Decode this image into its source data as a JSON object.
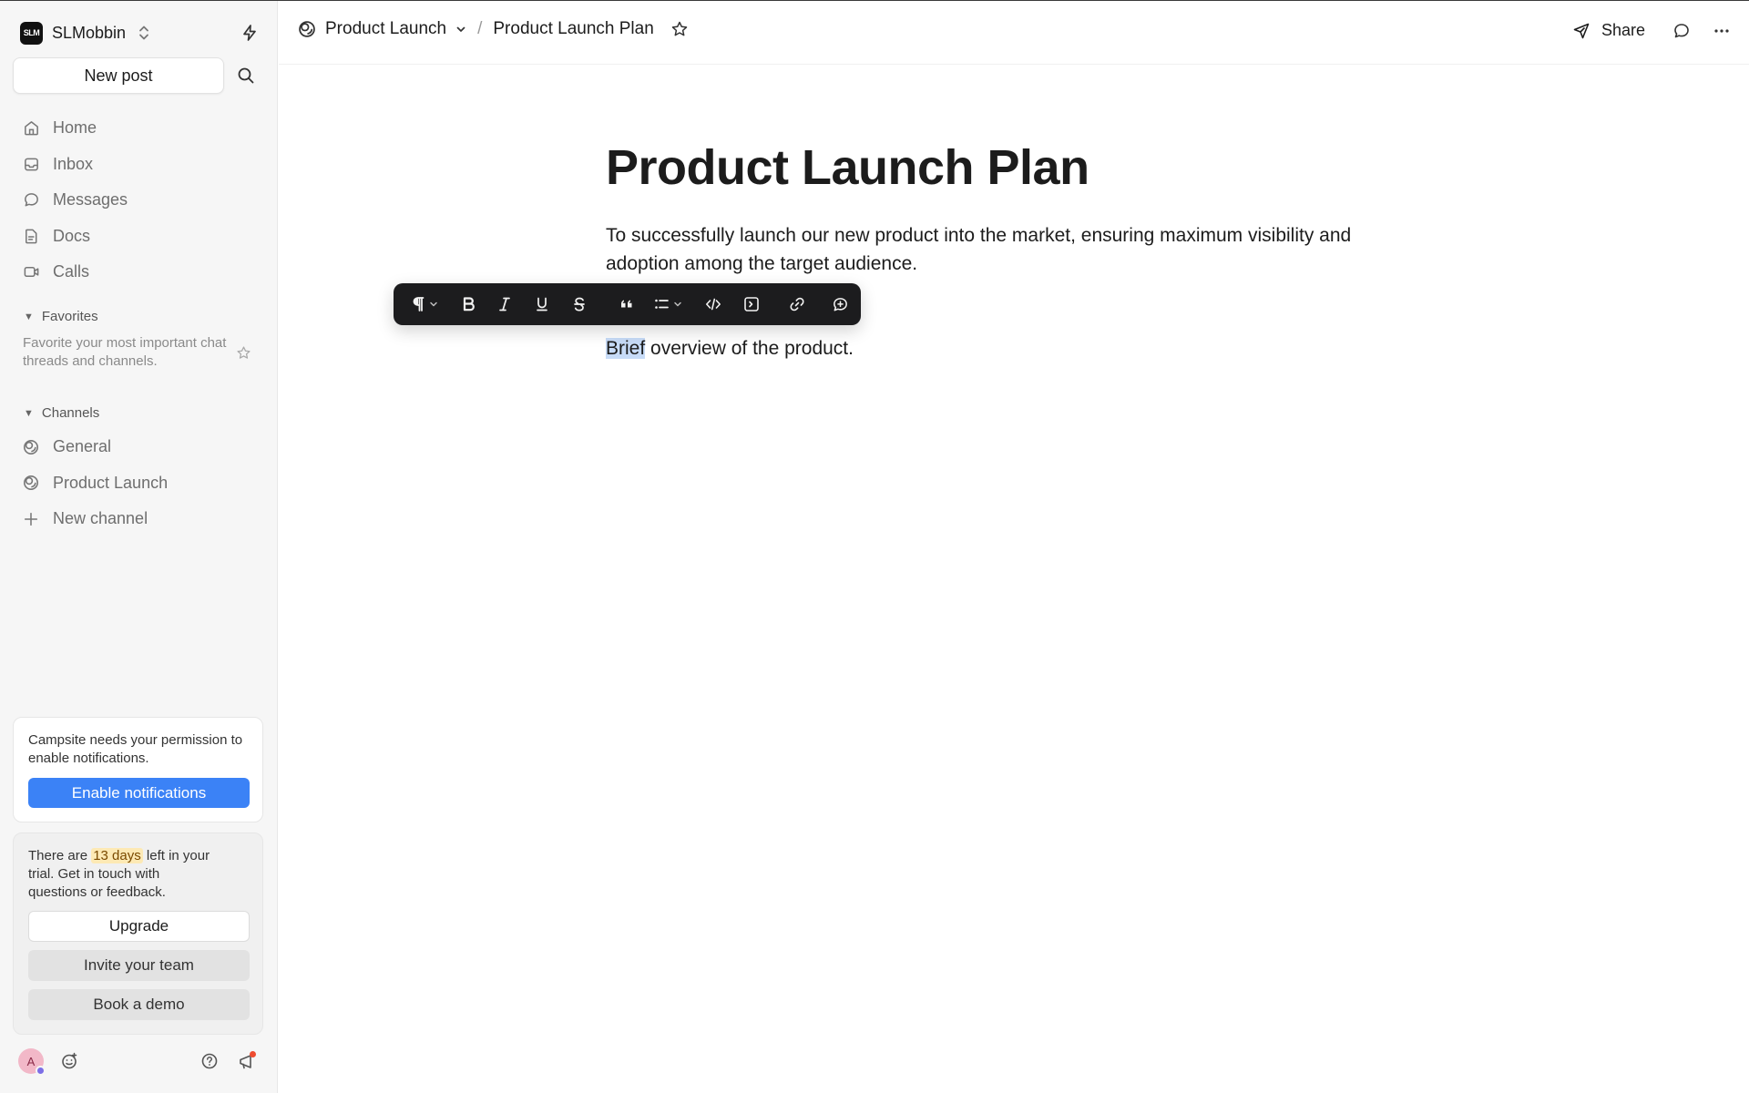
{
  "workspace": {
    "logo_text": "SLM",
    "name": "SLMobbin"
  },
  "sidebar": {
    "new_post_label": "New post",
    "nav": [
      {
        "label": "Home",
        "icon": "home-icon"
      },
      {
        "label": "Inbox",
        "icon": "inbox-icon"
      },
      {
        "label": "Messages",
        "icon": "message-icon"
      },
      {
        "label": "Docs",
        "icon": "doc-icon"
      },
      {
        "label": "Calls",
        "icon": "video-icon"
      }
    ],
    "favorites": {
      "heading": "Favorites",
      "empty_text": "Favorite your most important chat threads and channels."
    },
    "channels": {
      "heading": "Channels",
      "items": [
        {
          "label": "General",
          "icon": "channel-icon"
        },
        {
          "label": "Product Launch",
          "icon": "channel-icon"
        }
      ],
      "new_channel_label": "New channel"
    },
    "notification_card": {
      "text": "Campsite needs your permission to enable notifications.",
      "button_label": "Enable notifications"
    },
    "trial_card": {
      "text_before": "There are ",
      "days_highlight": "13 days",
      "text_after": " left in your trial. Get in touch with questions or feedback.",
      "upgrade_label": "Upgrade",
      "invite_label": "Invite your team",
      "demo_label": "Book a demo"
    },
    "footer": {
      "avatar_initial": "A"
    }
  },
  "topbar": {
    "channel_name": "Product Launch",
    "separator": "/",
    "doc_name": "Product Launch Plan",
    "share_label": "Share"
  },
  "document": {
    "title": "Product Launch Plan",
    "paragraph": "To successfully launch our new product into the market, ensuring maximum visibility and adoption among the target audience.",
    "line_selected": "Brief",
    "line_rest": " overview of the product."
  },
  "colors": {
    "accent": "#3b82f6",
    "selection": "#c7dbf7",
    "toolbar_bg": "#1c1c1e",
    "highlight": "#fde9b4",
    "notification_dot": "#ef4b2f"
  }
}
